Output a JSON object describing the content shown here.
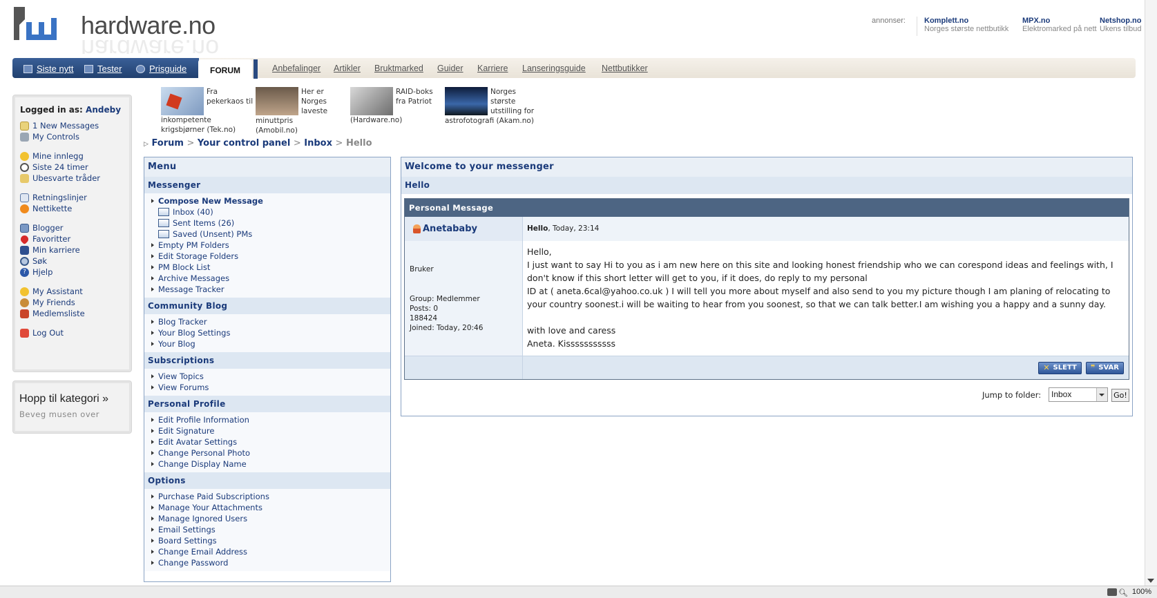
{
  "header": {
    "site_name": "hardware.no",
    "ads_label": "annonser:",
    "ads": [
      {
        "name": "Komplett.no",
        "tagline": "Norges største nettbutikk"
      },
      {
        "name": "MPX.no",
        "tagline": "Elektromarked på nett"
      },
      {
        "name": "Netshop.no",
        "tagline": "Ukens tilbud"
      }
    ]
  },
  "nav": {
    "primary": [
      "Siste nytt",
      "Tester",
      "Prisguide"
    ],
    "active_tab": "FORUM",
    "secondary": [
      "Anbefalinger",
      "Artikler",
      "Bruktmarked",
      "Guider",
      "Karriere",
      "Lanseringsguide",
      "Nettbutikker"
    ]
  },
  "sidebar": {
    "logged_in_label": "Logged in as:",
    "username": "Andeby",
    "groups": [
      [
        "1 New Messages",
        "My Controls"
      ],
      [
        "Mine innlegg",
        "Siste 24 timer",
        "Ubesvarte tråder"
      ],
      [
        "Retningslinjer",
        "Nettikette"
      ],
      [
        "Blogger",
        "Favoritter",
        "Min karriere",
        "Søk",
        "Hjelp"
      ],
      [
        "My Assistant",
        "My Friends",
        "Medlemsliste"
      ],
      [
        "Log Out"
      ]
    ],
    "category_title": "Hopp til kategori »",
    "category_hint": "Beveg musen over"
  },
  "news": [
    {
      "caption": "Fra pekerkaos til inkompetente krigsbjørner (Tek.no)"
    },
    {
      "caption": "Her er Norges laveste minuttpris (Amobil.no)"
    },
    {
      "caption": "RAID-boks fra Patriot (Hardware.no)"
    },
    {
      "caption": "Norges største utstilling for astrofotografi (Akam.no)"
    }
  ],
  "breadcrumb": [
    "Forum",
    "Your control panel",
    "Inbox",
    "Hello"
  ],
  "menu": {
    "title": "Menu",
    "sections": [
      {
        "title": "Messenger",
        "items": [
          "Compose New Message",
          "Inbox (40)",
          "Sent Items (26)",
          "Saved (Unsent) PMs",
          "Empty PM Folders",
          "Edit Storage Folders",
          "PM Block List",
          "Archive Messages",
          "Message Tracker"
        ]
      },
      {
        "title": "Community Blog",
        "items": [
          "Blog Tracker",
          "Your Blog Settings",
          "Your Blog"
        ]
      },
      {
        "title": "Subscriptions",
        "items": [
          "View Topics",
          "View Forums"
        ]
      },
      {
        "title": "Personal Profile",
        "items": [
          "Edit Profile Information",
          "Edit Signature",
          "Edit Avatar Settings",
          "Change Personal Photo",
          "Change Display Name"
        ]
      },
      {
        "title": "Options",
        "items": [
          "Purchase Paid Subscriptions",
          "Manage Your Attachments",
          "Manage Ignored Users",
          "Email Settings",
          "Board Settings",
          "Change Email Address",
          "Change Password"
        ]
      }
    ]
  },
  "messenger": {
    "title": "Welcome to your messenger",
    "subject_bar": "Hello",
    "pm_header": "Personal Message",
    "author": "Anetababy",
    "author_rank": "Bruker",
    "author_group": "Group: Medlemmer",
    "author_posts": "Posts: 0",
    "author_id": "188424",
    "author_joined": "Joined: Today, 20:46",
    "msg_title": "Hello",
    "msg_date": ", Today, 23:14",
    "body": [
      "Hello,",
      "I just want to say Hi to you as i am new here on this site and looking honest friendship who we can corespond ideas and feelings with, I don't know if this short letter will get to you, if it does, do reply to my personal",
      "ID at ( aneta.6cal@yahoo.co.uk ) I will tell you more about myself and also send to you my picture though I am planing of relocating to your country soonest.i will be waiting to hear from you soonest, so that we can talk better.I am wishing you a happy and a sunny day.",
      "",
      "with love and caress",
      "Aneta. Kisssssssssss"
    ],
    "delete_label": "SLETT",
    "reply_label": "SVAR",
    "jump_label": "Jump to folder:",
    "folder_value": "Inbox",
    "go_label": "Go!"
  },
  "statusbar": {
    "zoom": "100%"
  },
  "colors": {
    "accent": "#21406f",
    "link": "#1a3a7a",
    "panel_border": "#8aa3c4",
    "pm_header": "#4d6583"
  }
}
